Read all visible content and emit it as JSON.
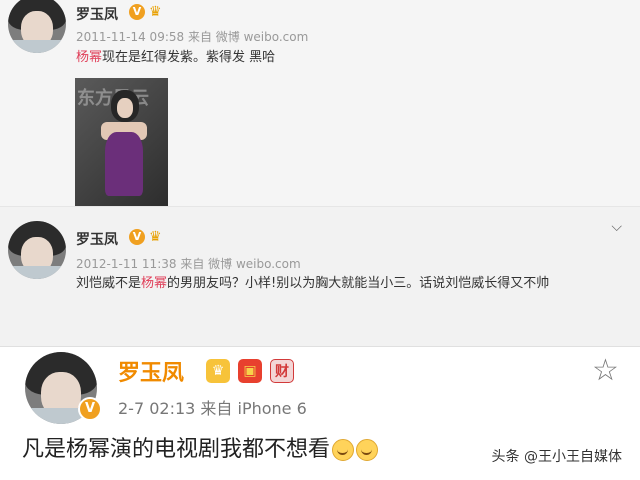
{
  "posts": [
    {
      "name": "罗玉凤",
      "meta": "2011-11-14 09:58 来自 微博 weibo.com",
      "content_parts": [
        "",
        "杨幂",
        "现在是红得发紫。紫得发 黑哈"
      ],
      "image_caption": "东方风云"
    },
    {
      "name": "罗玉凤",
      "meta": "2012-1-11 11:38 来自 微博 weibo.com",
      "content_parts": [
        "刘恺威不是",
        "杨幂",
        "的男朋友吗？小样!别以为胸大就能当小三。话说刘恺威长得又不帅"
      ]
    },
    {
      "name": "罗玉凤",
      "meta": "2-7 02:13  来自 iPhone 6",
      "content": "凡是杨幂演的电视剧我都不想看",
      "badge_v": "V",
      "badge_cai": "财"
    }
  ],
  "watermark": "头条 @王小王自媒体",
  "icons": {
    "verified": "verified-v-icon",
    "crown": "crown-icon",
    "chevron": "chevron-down-icon",
    "star": "star-icon",
    "redpacket": "red-packet-icon",
    "cai": "cai-badge-icon"
  },
  "colors": {
    "highlight": "#e0405a",
    "name_orange": "#f08a00",
    "meta_gray": "#999999"
  }
}
